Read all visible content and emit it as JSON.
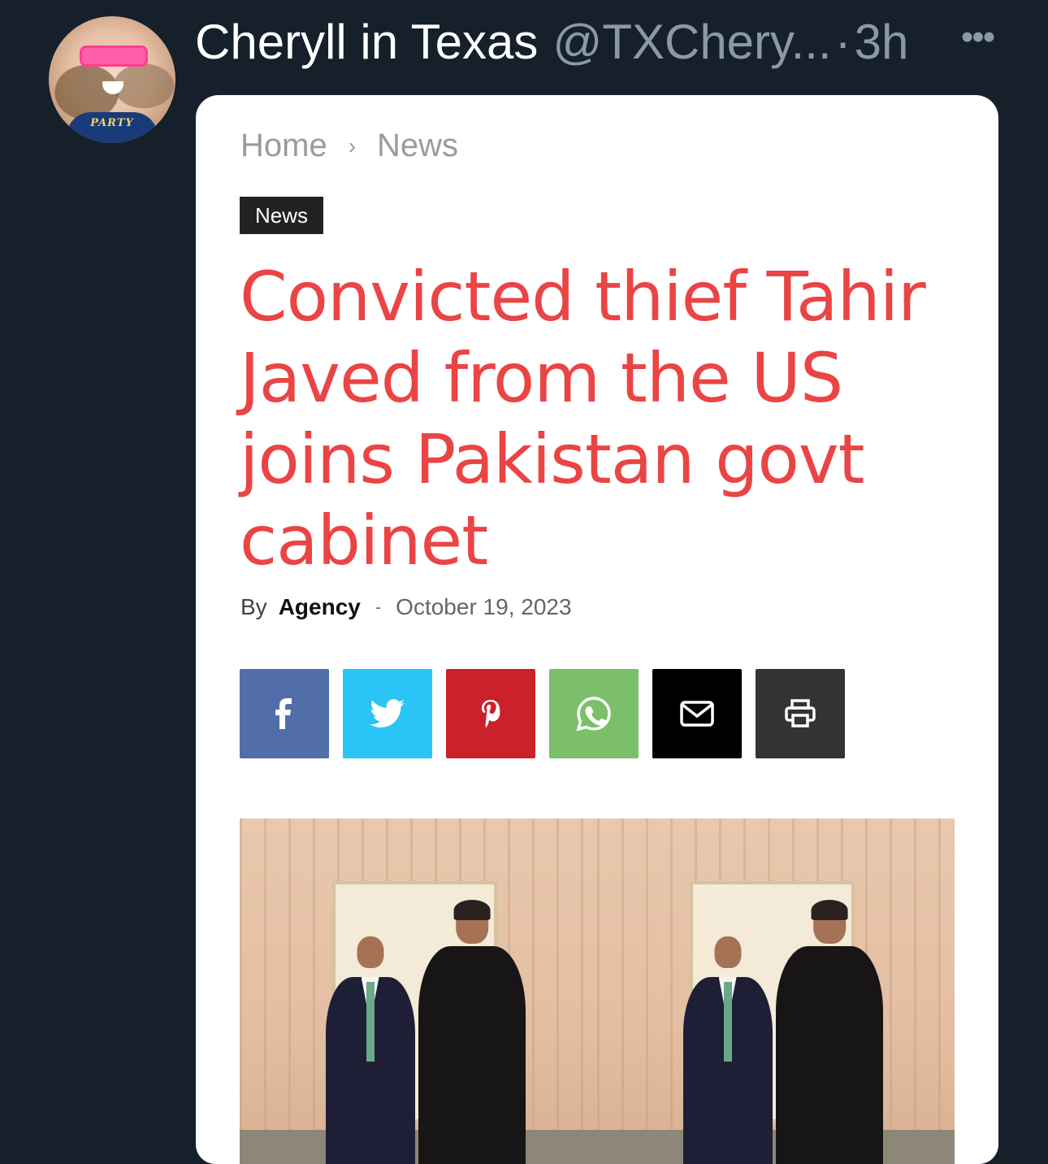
{
  "tweet": {
    "display_name": "Cheryll in Texas",
    "handle": "@TXChery...",
    "separator": "·",
    "time": "3h",
    "more_label": "•••",
    "avatar_text": "PARTY"
  },
  "article": {
    "breadcrumb": {
      "home": "Home",
      "separator": "›",
      "section": "News"
    },
    "category": "News",
    "headline": "Convicted thief Tahir Javed from the US joins Pakistan govt cabinet",
    "byline": {
      "by": "By",
      "author": "Agency",
      "dash": "-",
      "date": "October 19, 2023"
    },
    "share_buttons": [
      {
        "icon": "facebook-icon",
        "color": "#516eab"
      },
      {
        "icon": "twitter-icon",
        "color": "#29c5f6"
      },
      {
        "icon": "pinterest-icon",
        "color": "#ca212a"
      },
      {
        "icon": "whatsapp-icon",
        "color": "#7bbf6a"
      },
      {
        "icon": "email-icon",
        "color": "#000000"
      },
      {
        "icon": "print-icon",
        "color": "#333333"
      }
    ]
  },
  "colors": {
    "background": "#15202b",
    "headline": "#ea4444",
    "muted": "#8b98a5"
  }
}
